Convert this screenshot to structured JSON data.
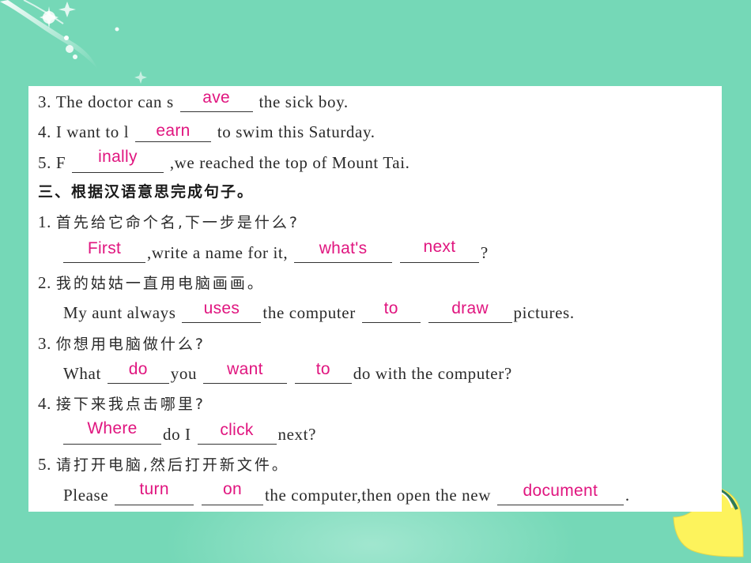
{
  "page": {
    "background_color": "#75d8b7",
    "answer_color": "#e0157f",
    "text_color": "#2a2a2a"
  },
  "part2_items": [
    {
      "number": "3.",
      "before": "The doctor can s",
      "answer": "ave",
      "after": "the sick boy."
    },
    {
      "number": "4.",
      "before": "I want to l",
      "answer": "earn",
      "after": "to swim this Saturday."
    },
    {
      "number": "5.",
      "before": "F",
      "answer": "inally",
      "after": ",we reached the top of Mount Tai."
    }
  ],
  "section3": {
    "heading": "三、根据汉语意思完成句子。",
    "items": [
      {
        "number": "1.",
        "chinese": "首先给它命个名,下一步是什么?",
        "parts": {
          "a1": "First",
          "t1": ",write a name for it,",
          "a2": "what's",
          "a3": "next",
          "t2": "?"
        }
      },
      {
        "number": "2.",
        "chinese": "我的姑姑一直用电脑画画。",
        "parts": {
          "t0": "My aunt always",
          "a1": "uses",
          "t1": "the computer",
          "a2": "to",
          "a3": "draw",
          "t2": "pictures."
        }
      },
      {
        "number": "3.",
        "chinese": "你想用电脑做什么?",
        "parts": {
          "t0": "What",
          "a1": "do",
          "t1": "you",
          "a2": "want",
          "a3": "to",
          "t2": "do with the computer?"
        }
      },
      {
        "number": "4.",
        "chinese": "接下来我点击哪里?",
        "parts": {
          "a1": "Where",
          "t1": "do I",
          "a2": "click",
          "t2": "next?"
        }
      },
      {
        "number": "5.",
        "chinese": "请打开电脑,然后打开新文件。",
        "parts": {
          "t0": "Please",
          "a1": "turn",
          "a2": "on",
          "t1": "the computer,then open the new",
          "a3": "document",
          "t2": "."
        }
      }
    ]
  }
}
